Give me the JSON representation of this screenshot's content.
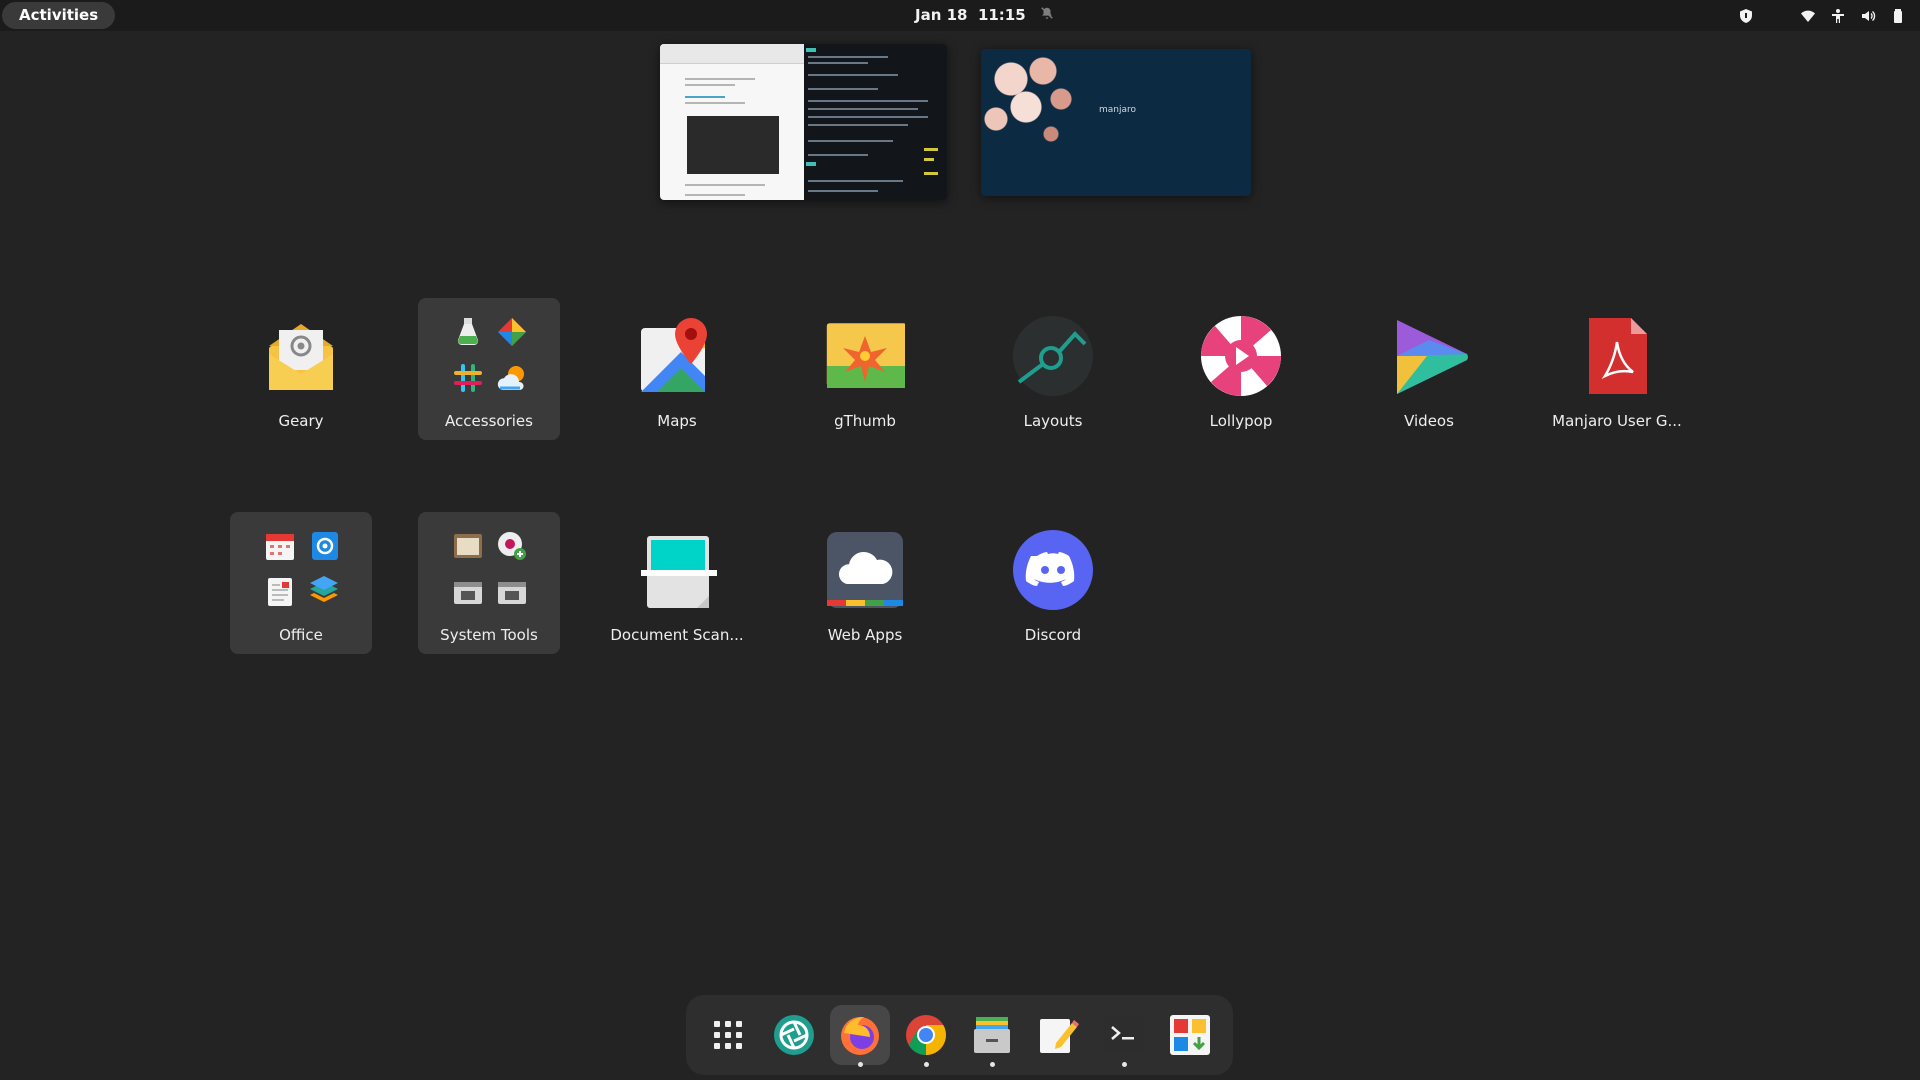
{
  "topbar": {
    "activities_label": "Activities",
    "date": "Jan 18",
    "time": "11:15",
    "tray_icons": [
      "shield-icon",
      "wifi-icon",
      "accessibility-icon",
      "volume-icon",
      "battery-icon"
    ]
  },
  "workspaces": {
    "workspace2_wallpaper_text": "manjaro"
  },
  "apps": {
    "row1": [
      {
        "label": "Geary",
        "icon": "mail-icon"
      },
      {
        "label": "Accessories",
        "icon": "folder-accessories"
      },
      {
        "label": "Maps",
        "icon": "maps-icon"
      },
      {
        "label": "gThumb",
        "icon": "gthumb-icon"
      },
      {
        "label": "Layouts",
        "icon": "layouts-icon"
      },
      {
        "label": "Lollypop",
        "icon": "lollypop-icon"
      },
      {
        "label": "Videos",
        "icon": "videos-icon"
      },
      {
        "label": "Manjaro User G...",
        "icon": "pdf-icon"
      }
    ],
    "row2": [
      {
        "label": "Office",
        "icon": "folder-office"
      },
      {
        "label": "System Tools",
        "icon": "folder-system-tools"
      },
      {
        "label": "Document Scan...",
        "icon": "scanner-icon"
      },
      {
        "label": "Web Apps",
        "icon": "cloud-icon"
      },
      {
        "label": "Discord",
        "icon": "discord-icon"
      }
    ]
  },
  "dock": {
    "items": [
      "show-apps-icon",
      "aperture-icon",
      "firefox-icon",
      "chrome-icon",
      "files-icon",
      "text-editor-icon",
      "terminal-icon",
      "software-center-icon"
    ]
  },
  "colors": {
    "background": "#232323",
    "topbar": "#1b1b1b",
    "folder_tile": "#3a3a3a",
    "accent_teal": "#1f9e8f",
    "discord": "#5865f2"
  }
}
